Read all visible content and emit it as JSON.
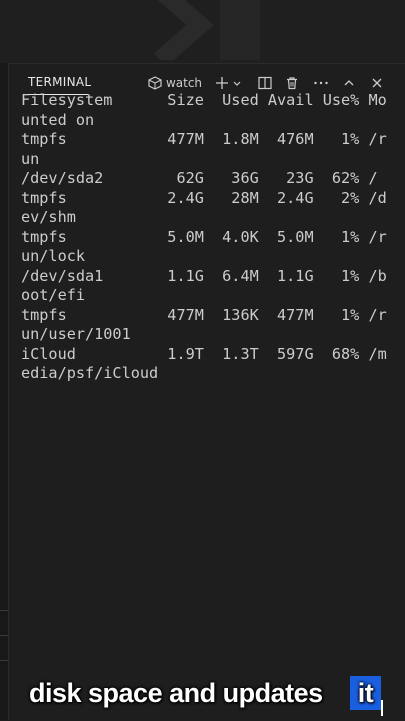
{
  "panel": {
    "tab_label": "TERMINAL",
    "watch_label": "watch",
    "icons": [
      "terminal-shell-icon",
      "plus-icon",
      "chevron-down-icon",
      "split-icon",
      "trash-icon",
      "more-icon",
      "chevron-up-icon",
      "close-icon"
    ]
  },
  "terminal": {
    "lines": [
      "Filesystem      Size  Used Avail Use% Mo",
      "unted on",
      "tmpfs           477M  1.8M  476M   1% /r",
      "un",
      "/dev/sda2        62G   36G   23G  62% /",
      "tmpfs           2.4G   28M  2.4G   2% /d",
      "ev/shm",
      "tmpfs           5.0M  4.0K  5.0M   1% /r",
      "un/lock",
      "/dev/sda1       1.1G  6.4M  1.1G   1% /b",
      "oot/efi",
      "tmpfs           477M  136K  477M   1% /r",
      "un/user/1001",
      "iCloud          1.9T  1.3T  597G  68% /m",
      "edia/psf/iCloud"
    ]
  },
  "caption": {
    "main": "disk space and updates",
    "highlight": "it"
  },
  "colors": {
    "background": "#1e1e1e",
    "text": "#cccccc",
    "highlight": "#1a5fe0"
  }
}
